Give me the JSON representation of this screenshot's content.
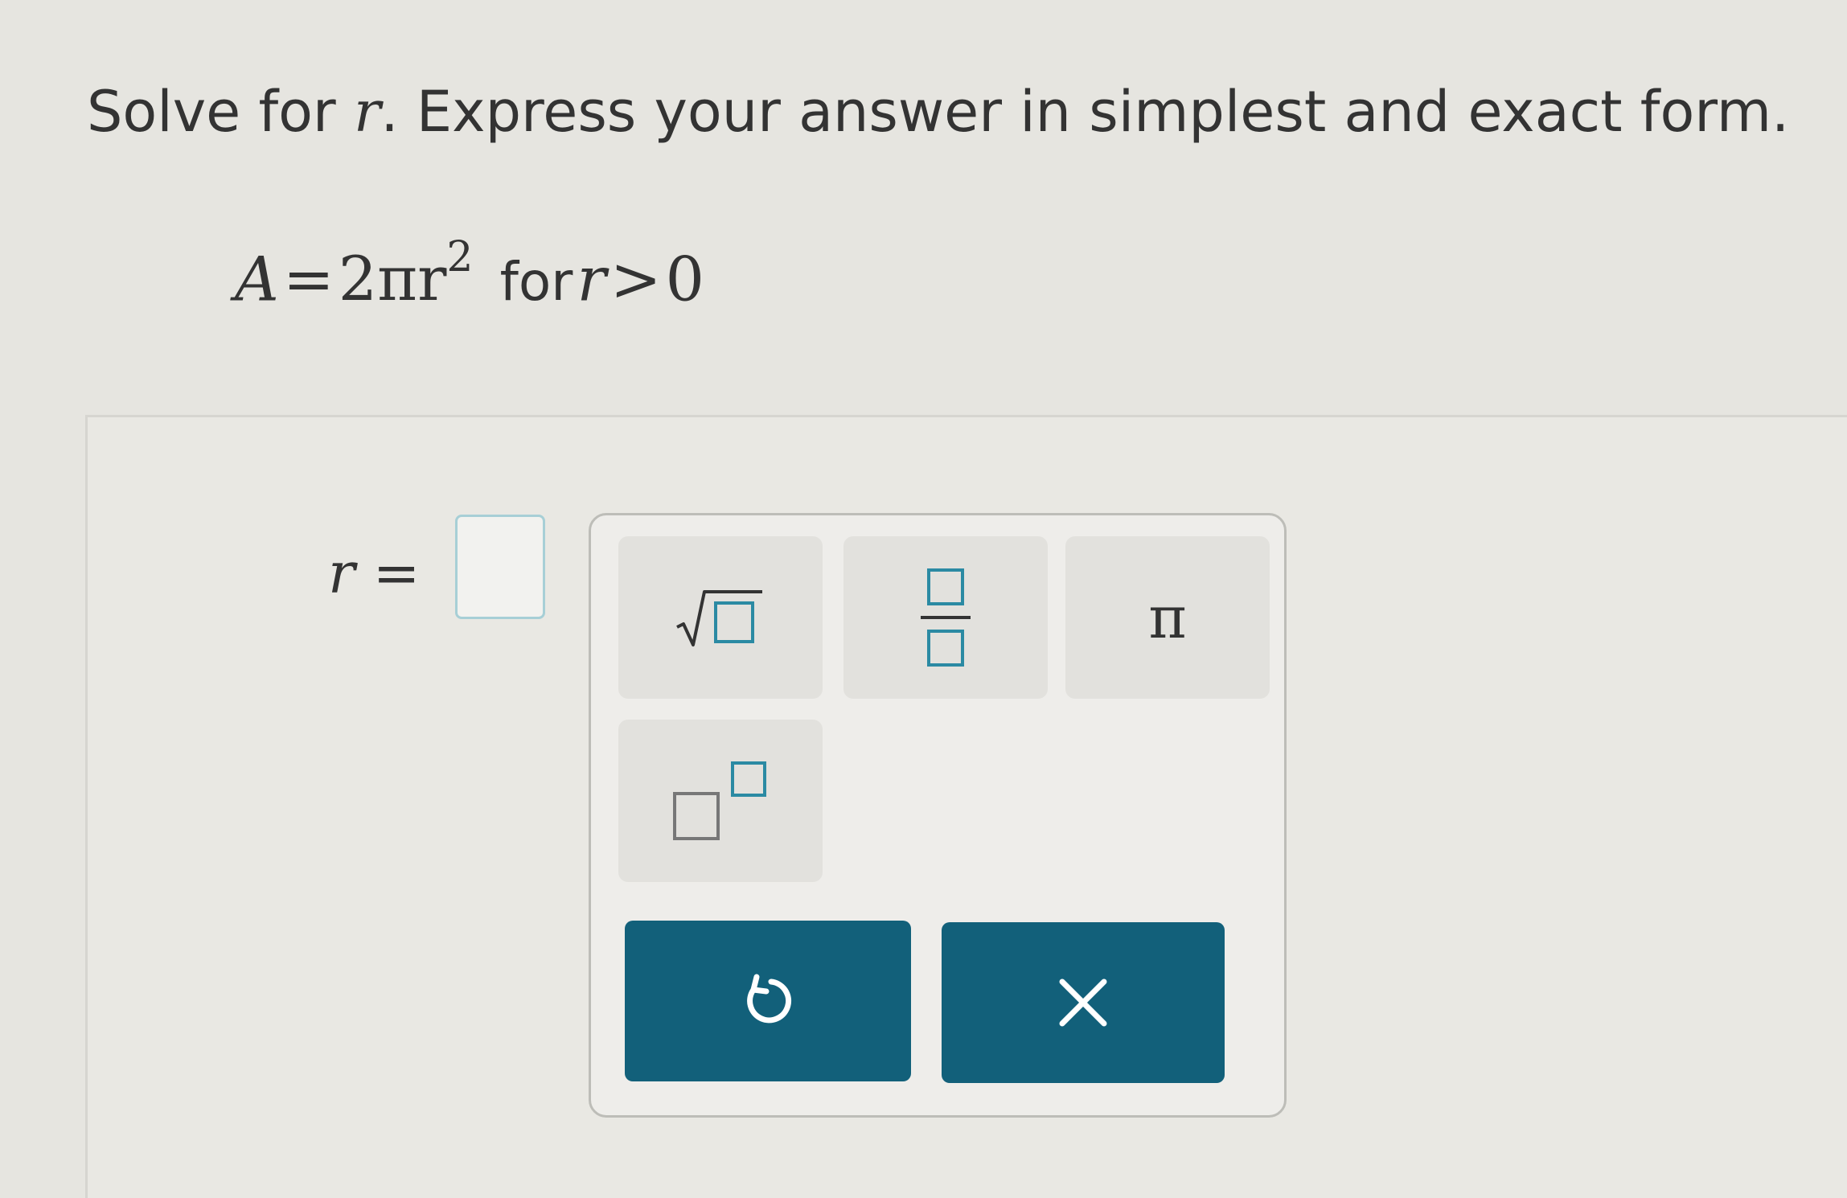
{
  "problem": {
    "instruction_prefix": "Solve for ",
    "variable": "r",
    "instruction_suffix": ". Express your answer in simplest and exact form."
  },
  "equation": {
    "lhs": "A",
    "equals": "=",
    "rhs_coef": "2πr",
    "exponent": "2",
    "for_text": "for",
    "condition_var": "r",
    "condition_op": ">",
    "condition_value": "0"
  },
  "answer": {
    "label_var": "r",
    "label_equals": "=",
    "value": ""
  },
  "keypad": {
    "keys": [
      {
        "name": "square-root",
        "icon": "sqrt-icon"
      },
      {
        "name": "fraction",
        "icon": "fraction-icon"
      },
      {
        "name": "pi",
        "glyph": "π"
      },
      {
        "name": "exponent",
        "icon": "superscript-icon"
      }
    ],
    "actions": [
      {
        "name": "undo",
        "icon": "undo-icon"
      },
      {
        "name": "clear",
        "icon": "close-icon"
      }
    ]
  },
  "colors": {
    "action_button": "#12607a",
    "answer_box_border": "#a7cfd6",
    "keypad_key": "#e2e1dd",
    "background": "#e6e5e0"
  }
}
